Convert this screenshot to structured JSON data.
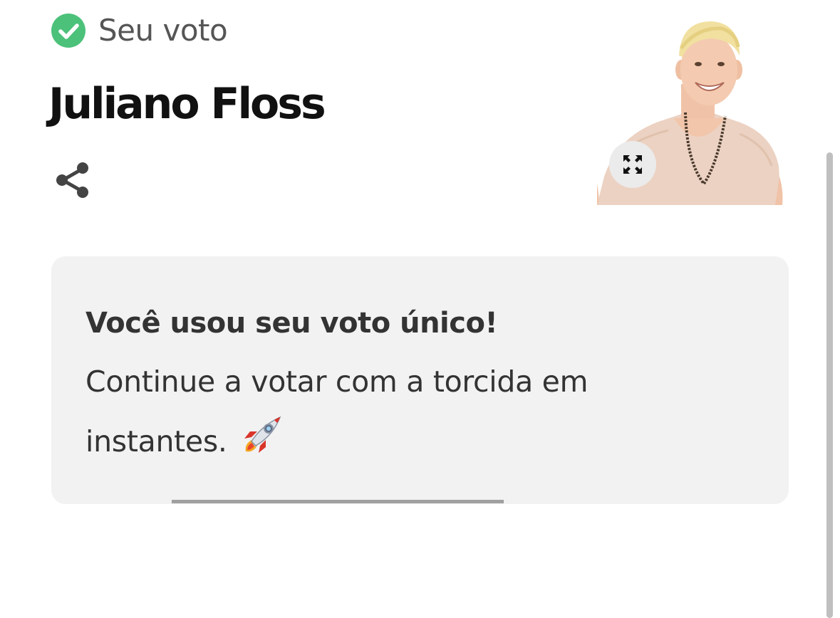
{
  "vote_status": {
    "label": "Seu voto",
    "icon": "check-circle-icon",
    "icon_color": "#4cc17a"
  },
  "candidate": {
    "name": "Juliano Floss",
    "photo_description": "candidate-photo",
    "share_icon": "share-icon",
    "expand_icon": "expand-icon"
  },
  "message": {
    "title": "Você usou seu voto único!",
    "body": "Continue a votar com a torcida em instantes.",
    "emoji_icon": "rocket-icon"
  },
  "progress": {
    "fraction": 1.0,
    "color": "#a0a0a0"
  },
  "colors": {
    "card_background": "#f2f2f2",
    "title_text": "#111111",
    "body_text": "#333333",
    "status_text": "#555555"
  }
}
